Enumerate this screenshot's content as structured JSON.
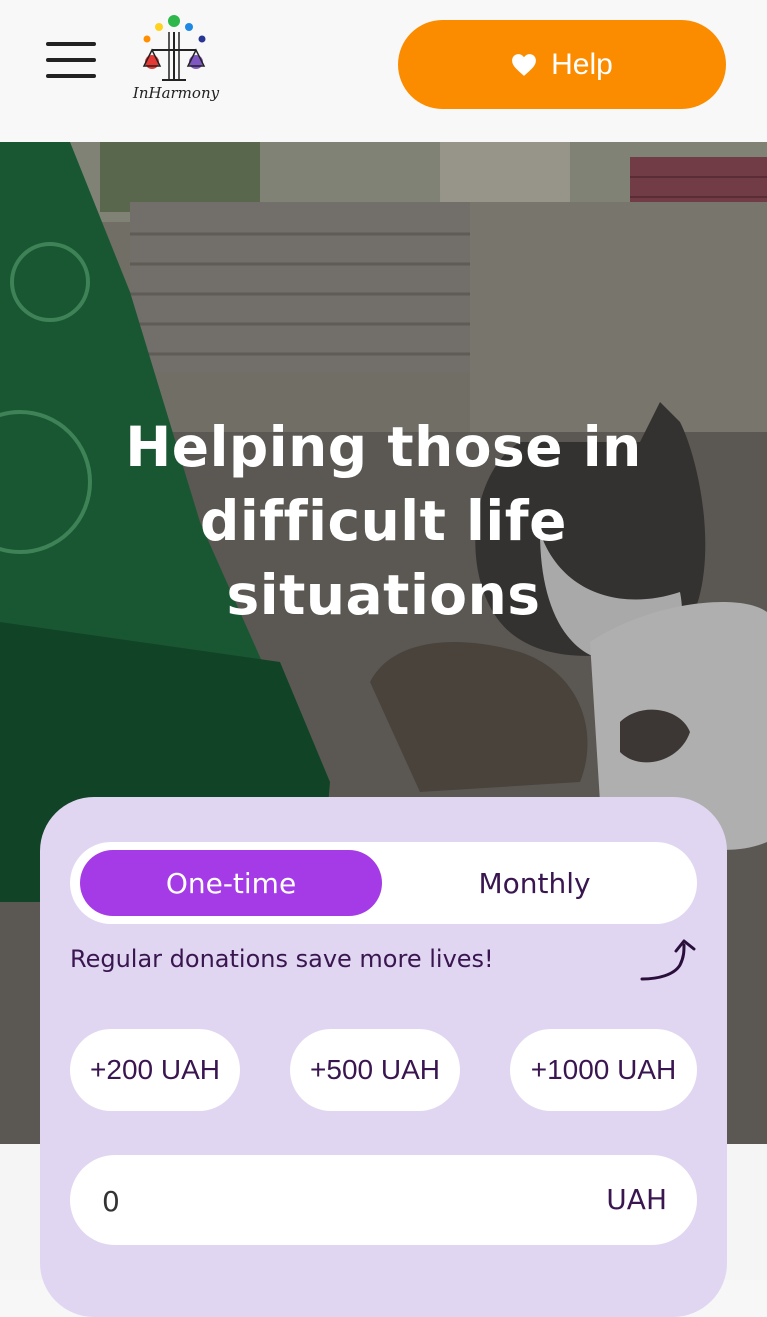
{
  "header": {
    "logo_text": "InHarmony",
    "help_label": "Help"
  },
  "hero": {
    "title_line1": "Helping those in",
    "title_line2": "difficult life",
    "title_line3": "situations"
  },
  "donation": {
    "frequency_options": [
      "One-time",
      "Monthly"
    ],
    "selected_frequency": "One-time",
    "note": "Regular donations save more lives!",
    "preset_amounts": [
      "+200 UAH",
      "+500 UAH",
      "+1000 UAH"
    ],
    "amount_value": "0",
    "currency": "UAH"
  },
  "colors": {
    "accent_orange": "#fb8c00",
    "accent_purple": "#a43be6",
    "card_lavender": "#e0d6f1",
    "text_dark_purple": "#3a1650"
  },
  "icons": [
    "hamburger-menu-icon",
    "logo-icon",
    "heart-icon",
    "curved-arrow-icon"
  ]
}
